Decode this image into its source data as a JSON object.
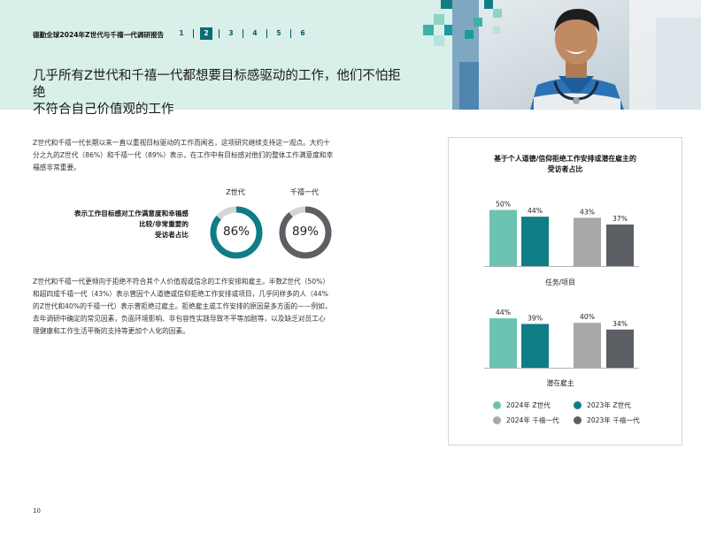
{
  "header": {
    "report_title": "德勤全球2024年Z世代与千禧一代调研报告",
    "pages": [
      "1",
      "2",
      "3",
      "4",
      "5",
      "6"
    ],
    "active_page": "2",
    "headline_line1": "几乎所有Z世代和千禧一代都想要目标感驱动的工作，他们不怕拒绝",
    "headline_line2": "不符合自己价值观的工作"
  },
  "body": {
    "para1_l1": "Z世代和千禧一代长期以来一直以重视目标驱动的工作而闻名，这项研究继续支持这一观点。大约十",
    "para1_l2": "分之九的Z世代（86%）和千禧一代（89%）表示，在工作中有目标感对他们的整体工作满意度和幸",
    "para1_l3": "福感非常重要。",
    "donut_label_l1": "表示工作目标感对工作满意度和幸福感",
    "donut_label_l2": "比较/非常重要的",
    "donut_label_l3": "受访者占比",
    "gen_z_label": "Z世代",
    "millennial_label": "千禧一代",
    "gen_z_value": "86%",
    "millennial_value": "89%",
    "gen_z_fraction": 0.86,
    "millennial_fraction": 0.89,
    "para2_l1": "Z世代和千禧一代更倾向于拒绝不符合其个人价值观或信念的工作安排和雇主。半数Z世代（50%）",
    "para2_l2": "和超四成千禧一代（43%）表示曾因个人道德或信仰拒绝工作安排或项目，几乎同样多的人（44%",
    "para2_l3": "的Z世代和40%的千禧一代）表示曾拒绝过雇主。拒绝雇主或工作安排的原因是多方面的——例如，",
    "para2_l4": "去年调研中确定的常见因素，负面环境影响、非包容性实践导致不平等加剧等，以及缺乏对员工心",
    "para2_l5": "理健康和工作生活平衡的支持等更加个人化的因素。"
  },
  "chart_data": {
    "type": "bar",
    "title_l1": "基于个人道德/信仰拒绝工作安排或潜在雇主的",
    "title_l2": "受访者占比",
    "categories": [
      "任务/项目",
      "潜在雇主"
    ],
    "series": [
      {
        "name": "2024年 Z世代",
        "values": [
          50,
          44
        ],
        "labels": [
          "50%",
          "44%"
        ],
        "color": "#6cc3b2"
      },
      {
        "name": "2023年 Z世代",
        "values": [
          44,
          39
        ],
        "labels": [
          "44%",
          "39%"
        ],
        "color": "#0f7d86"
      },
      {
        "name": "2024年 千禧一代",
        "values": [
          43,
          40
        ],
        "labels": [
          "43%",
          "40%"
        ],
        "color": "#a7a8aa"
      },
      {
        "name": "2023年 千禧一代",
        "values": [
          37,
          34
        ],
        "labels": [
          "37%",
          "34%"
        ],
        "color": "#5c5f63"
      }
    ]
  },
  "footer": {
    "page_number": "10"
  }
}
